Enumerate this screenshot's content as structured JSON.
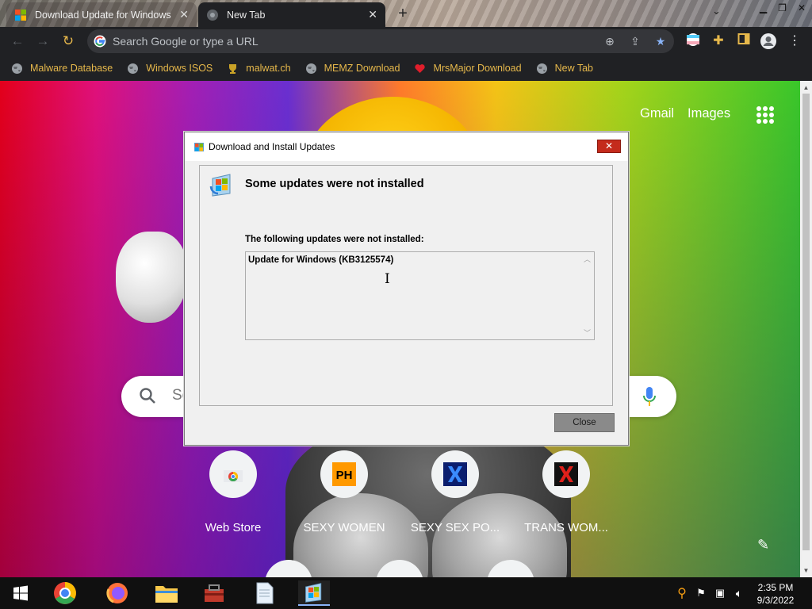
{
  "browser": {
    "tabs": [
      {
        "title": "Download Update for Windows",
        "active": false
      },
      {
        "title": "New Tab",
        "active": true
      }
    ],
    "omnibox_placeholder": "Search Google or type a URL",
    "bookmarks": [
      {
        "label": "Malware Database",
        "icon": "globe-icon"
      },
      {
        "label": "Windows ISOS",
        "icon": "globe-icon"
      },
      {
        "label": "malwat.ch",
        "icon": "trophy-icon"
      },
      {
        "label": "MEMZ Download",
        "icon": "globe-icon"
      },
      {
        "label": "MrsMajor Download",
        "icon": "heart-icon"
      },
      {
        "label": "New Tab",
        "icon": "globe-icon"
      }
    ]
  },
  "newtab": {
    "gmail_label": "Gmail",
    "images_label": "Images",
    "search_placeholder": "Se",
    "shortcuts": [
      {
        "label": "Web Store",
        "icon": "chrome-web-store-icon"
      },
      {
        "label": "SEXY WOMEN",
        "icon": "ph-icon"
      },
      {
        "label": "SEXY SEX PO...",
        "icon": "x-icon"
      },
      {
        "label": "TRANS WOM...",
        "icon": "x-icon"
      }
    ]
  },
  "dialog": {
    "title": "Download and Install Updates",
    "close_glyph": "✕",
    "heading": "Some updates were not installed",
    "subheading": "The following updates were not installed:",
    "failed_updates": [
      "Update for Windows (KB3125574)"
    ],
    "close_button": "Close"
  },
  "taskbar": {
    "apps": [
      "start-icon",
      "chrome-icon",
      "firefox-icon",
      "file-explorer-icon",
      "toolbox-icon",
      "notepad-icon",
      "windows-update-icon"
    ],
    "time": "2:35 PM",
    "date": "9/3/2022"
  },
  "colors": {
    "bookmark_text": "#e6b84b",
    "dialog_close": "#c42b1c",
    "chrome_dark": "#202124"
  }
}
